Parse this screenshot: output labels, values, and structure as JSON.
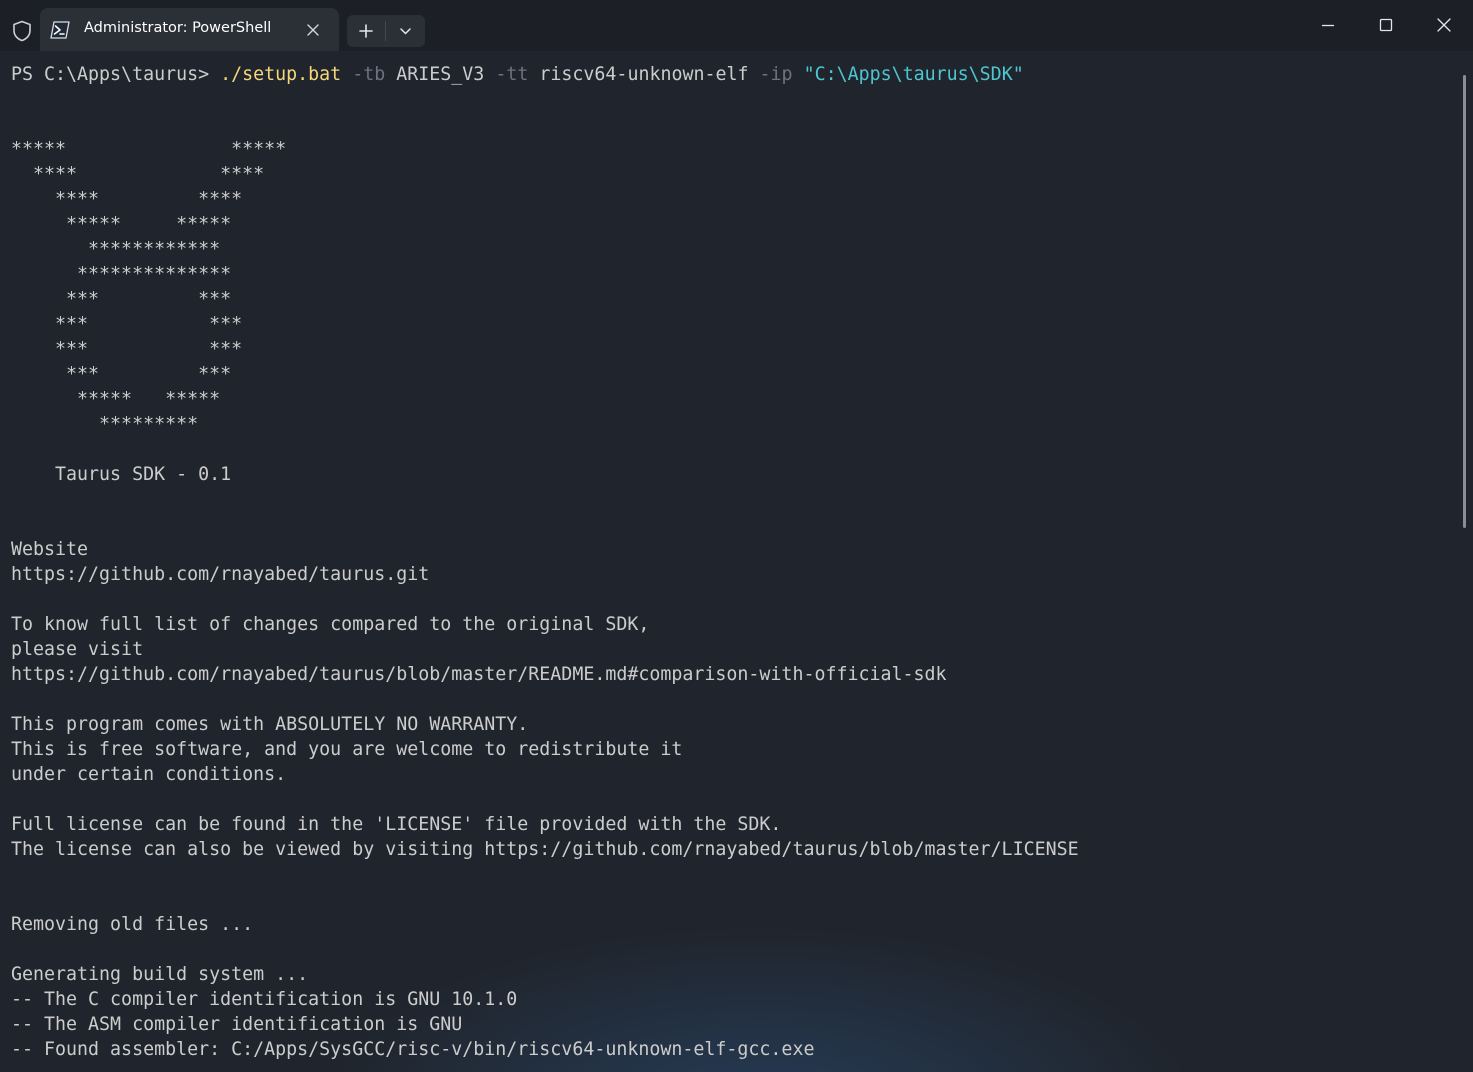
{
  "window": {
    "tab_title": "Administrator: PowerShell",
    "icons": {
      "shield": "shield-icon",
      "tab": "powershell-icon",
      "close_tab": "close-icon",
      "new_tab": "plus-icon",
      "dropdown": "chevron-down-icon",
      "minimize": "minimize-icon",
      "maximize": "maximize-icon",
      "close_window": "close-icon"
    },
    "colors": {
      "background": "#20252d",
      "titlebar": "#1c1f25",
      "tab": "#2b2f36",
      "text": "#cccccc",
      "command": "#f5d77b",
      "flag": "#6b7280",
      "string": "#4ec5cf"
    }
  },
  "terminal": {
    "prompt": "PS C:\\Apps\\taurus> ",
    "command": "./setup.bat",
    "args": [
      {
        "kind": "flag",
        "text": "-tb"
      },
      {
        "kind": "value",
        "text": "ARIES_V3"
      },
      {
        "kind": "flag",
        "text": "-tt"
      },
      {
        "kind": "value",
        "text": "riscv64-unknown-elf"
      },
      {
        "kind": "flag",
        "text": "-ip"
      },
      {
        "kind": "string",
        "text": "\"C:\\Apps\\taurus\\SDK\""
      }
    ],
    "output": [
      "",
      "",
      "*****               *****",
      "  ****             ****",
      "    ****         ****",
      "     *****     *****",
      "       ************",
      "      **************",
      "     ***         ***",
      "    ***           ***",
      "    ***           ***",
      "     ***         ***",
      "      *****   *****",
      "        *********",
      "",
      "    Taurus SDK - 0.1",
      "",
      "",
      "Website",
      "https://github.com/rnayabed/taurus.git",
      "",
      "To know full list of changes compared to the original SDK,",
      "please visit",
      "https://github.com/rnayabed/taurus/blob/master/README.md#comparison-with-official-sdk",
      "",
      "This program comes with ABSOLUTELY NO WARRANTY.",
      "This is free software, and you are welcome to redistribute it",
      "under certain conditions.",
      "",
      "Full license can be found in the 'LICENSE' file provided with the SDK.",
      "The license can also be viewed by visiting https://github.com/rnayabed/taurus/blob/master/LICENSE",
      "",
      "",
      "Removing old files ...",
      "",
      "Generating build system ...",
      "-- The C compiler identification is GNU 10.1.0",
      "-- The ASM compiler identification is GNU",
      "-- Found assembler: C:/Apps/SysGCC/risc-v/bin/riscv64-unknown-elf-gcc.exe"
    ]
  }
}
